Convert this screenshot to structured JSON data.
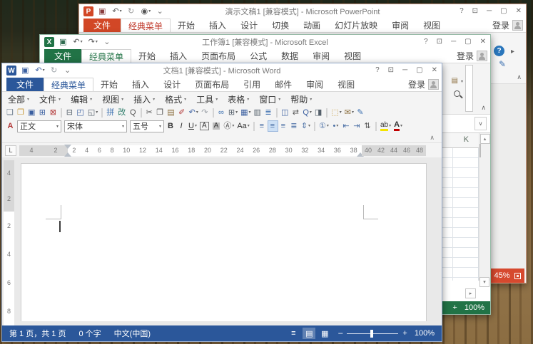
{
  "chrome": {
    "help": "?",
    "ribbon_options": "⊡",
    "minimize": "─",
    "maximize": "▢",
    "close": "✕"
  },
  "glyphs": {
    "dropdown": "▾",
    "collapse": "∧",
    "expand": "∨",
    "scroll_up": "▴",
    "scroll_down": "▾",
    "scroll_right": "▸",
    "arrow_right": "▸"
  },
  "ppt": {
    "accent": "#D24726",
    "app_letter": "P",
    "title": "演示文稿1 [兼容模式] - Microsoft PowerPoint",
    "file_tab": "文件",
    "signin": "登录",
    "qat": [
      {
        "n": "save-icon",
        "g": "▣",
        "c": "#8a3d3d"
      },
      {
        "n": "undo-icon",
        "g": "↶",
        "c": "#555",
        "d": "▾"
      },
      {
        "n": "redo-icon",
        "g": "↻",
        "c": "#999"
      },
      {
        "n": "start-slideshow-icon",
        "g": "◉",
        "c": "#555",
        "d": "▾"
      },
      {
        "n": "qat-menu-icon",
        "g": "⌄",
        "c": "#777"
      }
    ],
    "tabs": [
      {
        "label": "经典菜单",
        "active": true
      },
      {
        "label": "开始"
      },
      {
        "label": "插入"
      },
      {
        "label": "设计"
      },
      {
        "label": "切换"
      },
      {
        "label": "动画"
      },
      {
        "label": "幻灯片放映"
      },
      {
        "label": "审阅"
      },
      {
        "label": "视图"
      }
    ],
    "fragments": {
      "help": "?",
      "edit": "✎"
    },
    "badge": {
      "zoom": "45%"
    }
  },
  "excel": {
    "accent": "#217346",
    "app_letter": "X",
    "title": "工作簿1 [兼容模式] - Microsoft Excel",
    "file_tab": "文件",
    "signin": "登录",
    "qat": [
      {
        "n": "save-icon",
        "g": "▣",
        "c": "#2f6b4f"
      },
      {
        "n": "undo-icon",
        "g": "↶",
        "c": "#555",
        "d": "▾"
      },
      {
        "n": "redo-icon",
        "g": "↷",
        "c": "#555",
        "d": "▾"
      },
      {
        "n": "qat-menu-icon",
        "g": "⌄",
        "c": "#777"
      }
    ],
    "tabs": [
      {
        "label": "经典菜单",
        "active": true
      },
      {
        "label": "开始"
      },
      {
        "label": "插入"
      },
      {
        "label": "页面布局"
      },
      {
        "label": "公式"
      },
      {
        "label": "数据"
      },
      {
        "label": "审阅"
      },
      {
        "label": "视图"
      }
    ],
    "fragments": {
      "toolbar_icon": "▤",
      "col_header": "K"
    },
    "badge": {
      "plus": "+",
      "zoom": "100%"
    }
  },
  "word": {
    "accent": "#2B579A",
    "app_letter": "W",
    "title": "文档1 [兼容模式] - Microsoft Word",
    "file_tab": "文件",
    "signin": "登录",
    "qat": [
      {
        "n": "save-icon",
        "g": "▣",
        "c": "#3a5fa0"
      },
      {
        "n": "undo-icon",
        "g": "↶",
        "c": "#3a5fa0",
        "d": "▾"
      },
      {
        "n": "redo-icon",
        "g": "↻",
        "c": "#9aa0a6"
      },
      {
        "n": "qat-menu-icon",
        "g": "⌄",
        "c": "#777"
      }
    ],
    "tabs": [
      {
        "label": "经典菜单",
        "active": true
      },
      {
        "label": "开始"
      },
      {
        "label": "插入"
      },
      {
        "label": "设计"
      },
      {
        "label": "页面布局"
      },
      {
        "label": "引用"
      },
      {
        "label": "邮件"
      },
      {
        "label": "审阅"
      },
      {
        "label": "视图"
      }
    ],
    "menus": [
      {
        "n": "menu-all",
        "label": "全部",
        "d": "▾"
      },
      {
        "n": "menu-file",
        "label": "文件",
        "d": "▾"
      },
      {
        "n": "menu-edit",
        "label": "编辑",
        "d": "▾"
      },
      {
        "n": "menu-view",
        "label": "视图",
        "d": "▾"
      },
      {
        "n": "menu-insert",
        "label": "插入",
        "d": "▾"
      },
      {
        "n": "menu-format",
        "label": "格式",
        "d": "▾"
      },
      {
        "n": "menu-tools",
        "label": "工具",
        "d": "▾"
      },
      {
        "n": "menu-table",
        "label": "表格",
        "d": "▾"
      },
      {
        "n": "menu-window",
        "label": "窗口",
        "d": "▾"
      },
      {
        "n": "menu-help",
        "label": "帮助",
        "d": "▾"
      }
    ],
    "toolbar1": [
      {
        "n": "new-document-icon",
        "g": "❏",
        "c": "#6b7b8d"
      },
      {
        "n": "open-folder-icon",
        "g": "❒",
        "c": "#c79a3b"
      },
      {
        "n": "save-icon",
        "g": "▣",
        "c": "#3a5fa0"
      },
      {
        "n": "save-as-icon",
        "g": "⊞",
        "c": "#3a5fa0"
      },
      {
        "n": "close-file-icon",
        "g": "⊠",
        "c": "#b33a3a"
      },
      {
        "sep": true
      },
      {
        "n": "print-icon",
        "g": "⊟",
        "c": "#55606b"
      },
      {
        "n": "print-preview-icon",
        "g": "◰",
        "c": "#3a5fa0"
      },
      {
        "n": "print-options-icon",
        "g": "◱",
        "c": "#55606b",
        "d": "▾"
      },
      {
        "sep": true
      },
      {
        "n": "pinyin-guide-icon",
        "g": "拼",
        "c": "#3a6fb0"
      },
      {
        "n": "proofing-icon",
        "g": "改",
        "c": "#2e7d6b"
      },
      {
        "n": "find-icon",
        "g": "Q",
        "c": "#555"
      },
      {
        "sep": true
      },
      {
        "n": "cut-icon",
        "g": "✂",
        "c": "#555"
      },
      {
        "n": "copy-icon",
        "g": "❐",
        "c": "#555"
      },
      {
        "n": "paste-icon",
        "g": "▤",
        "c": "#8a6d3b"
      },
      {
        "n": "format-painter-icon",
        "g": "✐",
        "c": "#b33a3a"
      },
      {
        "n": "undo-icon",
        "g": "↶",
        "c": "#3a5fa0",
        "d": "▾"
      },
      {
        "n": "redo-icon",
        "g": "↷",
        "c": "#9aa0a6"
      },
      {
        "sep": true
      },
      {
        "n": "hyperlink-icon",
        "g": "∞",
        "c": "#3a6fb0"
      },
      {
        "n": "insert-table-icon",
        "g": "⊞",
        "c": "#55606b",
        "d": "▾"
      },
      {
        "n": "table-style-icon",
        "g": "▦",
        "c": "#3a5fa0",
        "d": "▾"
      },
      {
        "n": "columns-icon",
        "g": "▥",
        "c": "#55606b"
      },
      {
        "n": "document-map-icon",
        "g": "≣",
        "c": "#3a6fb0"
      },
      {
        "sep": true
      },
      {
        "n": "split-window-icon",
        "g": "◫",
        "c": "#3a5fa0"
      },
      {
        "n": "shrink-page-icon",
        "g": "⇄",
        "c": "#555"
      },
      {
        "n": "zoom-icon",
        "g": "Q",
        "c": "#3a5fa0",
        "d": "▾"
      },
      {
        "n": "read-layout-icon",
        "g": "◨",
        "c": "#55606b"
      },
      {
        "sep": true
      },
      {
        "n": "comment-icon",
        "g": "⬚",
        "c": "#c79a3b",
        "d": "▾"
      },
      {
        "n": "envelope-icon",
        "g": "✉",
        "c": "#8a6d3b",
        "d": "▾"
      },
      {
        "n": "edit-icon",
        "g": "✎",
        "c": "#3a6fb0"
      }
    ],
    "format": {
      "styles_icon": "A",
      "style_value": "正文",
      "font_value": "宋体",
      "size_value": "五号"
    },
    "toolbar2": [
      {
        "n": "bold-icon",
        "g": "B",
        "c": "#333",
        "cls": "bold"
      },
      {
        "n": "italic-icon",
        "g": "I",
        "c": "#333",
        "cls": "ital"
      },
      {
        "n": "underline-icon",
        "g": "U",
        "c": "#333",
        "cls": "und",
        "d": "▾"
      },
      {
        "n": "character-border-icon",
        "g": "A",
        "c": "#333",
        "cls": "boxed"
      },
      {
        "n": "character-shading-icon",
        "g": "A",
        "c": "#333",
        "cls": "shaded"
      },
      {
        "n": "enclose-character-icon",
        "g": "Ⓐ",
        "c": "#555",
        "d": "▾"
      },
      {
        "n": "change-case-icon",
        "g": "Aa",
        "c": "#333",
        "d": "▾"
      },
      {
        "sep": true
      },
      {
        "n": "align-left-icon",
        "g": "≡",
        "c": "#4a6fa5"
      },
      {
        "n": "center-icon",
        "g": "≡",
        "c": "#4a6fa5",
        "active": true
      },
      {
        "n": "align-right-icon",
        "g": "≡",
        "c": "#4a6fa5"
      },
      {
        "n": "distribute-icon",
        "g": "≣",
        "c": "#4a6fa5"
      },
      {
        "n": "line-spacing-icon",
        "g": "⇕",
        "c": "#4a6fa5",
        "d": "▾"
      },
      {
        "sep": true
      },
      {
        "n": "numbering-icon",
        "g": "①",
        "c": "#4a6fa5",
        "d": "▾"
      },
      {
        "n": "bullets-icon",
        "g": "•",
        "c": "#4a6fa5",
        "d": "▾"
      },
      {
        "n": "decrease-indent-icon",
        "g": "⇤",
        "c": "#4a6fa5"
      },
      {
        "n": "increase-indent-icon",
        "g": "⇥",
        "c": "#4a6fa5"
      },
      {
        "n": "sort-icon",
        "g": "⇅",
        "c": "#555"
      },
      {
        "sep": true
      },
      {
        "n": "highlight-icon",
        "g": "ab",
        "c": "#333",
        "cls": "hl",
        "d": "▾"
      },
      {
        "n": "font-color-icon",
        "g": "A",
        "c": "#333",
        "cls": "fc",
        "d": "▾"
      }
    ],
    "ruler": {
      "tab_selector": "L",
      "margin_numbers": [
        "4",
        "2"
      ],
      "numbers": [
        "2",
        "4",
        "6",
        "8",
        "10",
        "12",
        "14",
        "16",
        "18",
        "20",
        "22",
        "24",
        "26",
        "28",
        "30",
        "32",
        "34",
        "36",
        "38"
      ],
      "right_numbers": [
        "40",
        "42",
        "44",
        "46",
        "48"
      ]
    },
    "vruler": {
      "margin_numbers": [
        "4",
        "2"
      ],
      "numbers": [
        "2",
        "4",
        "6",
        "8"
      ]
    },
    "status": {
      "page_info": "第 1 页，共 1 页",
      "word_count": "0 个字",
      "language": "中文(中国)",
      "views": [
        {
          "n": "read-mode-icon",
          "g": "≡"
        },
        {
          "n": "print-layout-icon",
          "g": "▤",
          "active": true
        },
        {
          "n": "web-layout-icon",
          "g": "▦"
        }
      ],
      "zoom_out": "–",
      "zoom_in": "+",
      "zoom_level": "100%"
    }
  }
}
